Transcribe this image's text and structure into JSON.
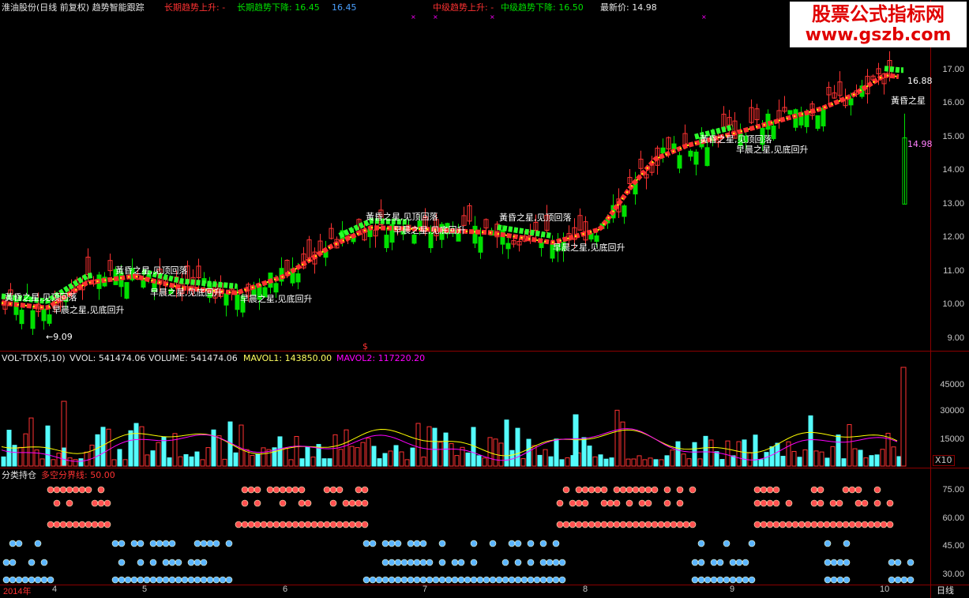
{
  "header": {
    "title": "淮油股份(日线 前复权) 趋势智能跟踪",
    "long_up": "长期趋势上升: -",
    "long_down": "长期趋势下降: 16.45",
    "long_val2": "16.45",
    "mid_up": "中级趋势上升: -",
    "mid_down": "中级趋势下降: 16.50",
    "latest": "最新价: 14.98"
  },
  "watermark": {
    "line1": "股票公式指标网",
    "line2": "www.gszb.com"
  },
  "price_axis": [
    "17.00",
    "16.00",
    "15.00",
    "14.00",
    "13.00",
    "12.00",
    "11.00",
    "10.00",
    "9.00"
  ],
  "price_labels": {
    "low": "9.09",
    "last_close": "16.88",
    "current": "14.98",
    "marker": "$"
  },
  "annotations": [
    {
      "id": "a1",
      "text": "黃昏之星,见顶回落"
    },
    {
      "id": "a2",
      "text": "早晨之星,见底回升"
    },
    {
      "id": "a3",
      "text": "黃昏之星,见顶回落"
    },
    {
      "id": "a4",
      "text": "早晨之星,见底回升"
    },
    {
      "id": "a5",
      "text": "早晨之星,见底回升"
    },
    {
      "id": "a6",
      "text": "黃昏之星,见顶回落"
    },
    {
      "id": "a7",
      "text": "早晨之星,见底回升"
    },
    {
      "id": "a8",
      "text": "黃昏之星,见顶回落"
    },
    {
      "id": "a9",
      "text": "早晨之星,见底回升"
    },
    {
      "id": "a10",
      "text": "黃昏之星,见顶回落"
    },
    {
      "id": "a11",
      "text": "早晨之星,见底回升"
    },
    {
      "id": "a12",
      "text": "黃昏之星"
    }
  ],
  "vol_pane": {
    "name": "VOL-TDX(5,10)",
    "vvol": "VVOL: 541474.06",
    "volume": "VOLUME: 541474.06",
    "mavol1": "MAVOL1: 143850.00",
    "mavol2": "MAVOL2: 117220.20",
    "axis": [
      "45000",
      "30000",
      "15000"
    ],
    "unit": "X10"
  },
  "pos_pane": {
    "name": "分类持仓",
    "line": "多空分界线: 50.00",
    "axis": [
      "75.00",
      "60.00",
      "45.00",
      "30.00"
    ]
  },
  "x_axis": [
    "2014年",
    "4",
    "5",
    "6",
    "7",
    "8",
    "9",
    "10"
  ],
  "period": "日线",
  "colors": {
    "up": "#ff3232",
    "down": "#54fcfc",
    "k_down": "#00e000",
    "ma1": "#ffff00",
    "ma2": "#ff00ff",
    "grid": "#8b0000"
  }
}
